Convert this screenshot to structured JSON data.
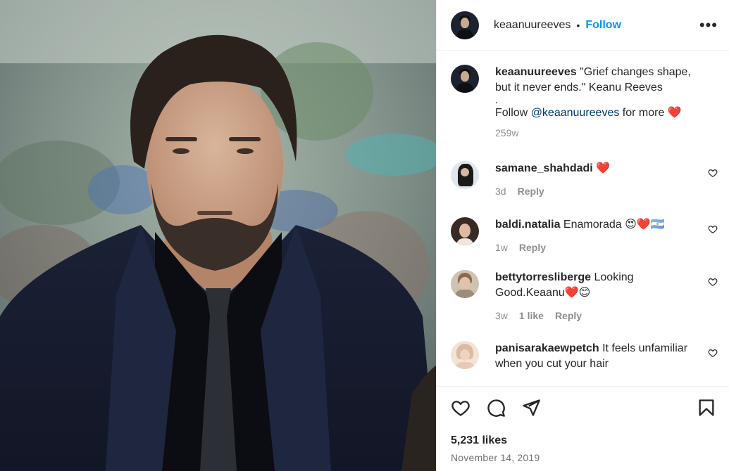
{
  "header": {
    "username": "keaanuureeves",
    "separator": "•",
    "follow_label": "Follow",
    "more_label": "•••"
  },
  "caption": {
    "username": "keaanuureeves",
    "text_line1": "\"Grief changes shape, but it never ends.\" Keanu Reeves",
    "text_dot": ".",
    "follow_prefix": "Follow ",
    "mention": "@keaanuureeves",
    "follow_suffix": " for more ",
    "heart": "❤️",
    "time": "259w"
  },
  "comments": [
    {
      "username": "samane_shahdadi",
      "text": "❤️",
      "time": "3d",
      "likes": "",
      "reply_label": "Reply"
    },
    {
      "username": "baldi.natalia",
      "text": "Enamorada 😍❤️🇦🇷",
      "time": "1w",
      "likes": "",
      "reply_label": "Reply"
    },
    {
      "username": "bettytorresliberge",
      "text": "Looking Good.Keaanu❤️😊",
      "time": "3w",
      "likes": "1 like",
      "reply_label": "Reply"
    },
    {
      "username": "panisarakaewpetch",
      "text": "It feels unfamiliar when you cut your hair",
      "time": "",
      "likes": "",
      "reply_label": ""
    }
  ],
  "actions": {
    "like_icon": "heart-outline-icon",
    "comment_icon": "comment-bubble-icon",
    "share_icon": "paper-plane-icon",
    "save_icon": "bookmark-icon"
  },
  "likes_count": "5,231 likes",
  "date": "November 14, 2019",
  "colors": {
    "link_blue": "#0095f6",
    "mention_blue": "#00376b",
    "muted_text": "#8e8e8e",
    "heart_red": "#e0151c"
  }
}
